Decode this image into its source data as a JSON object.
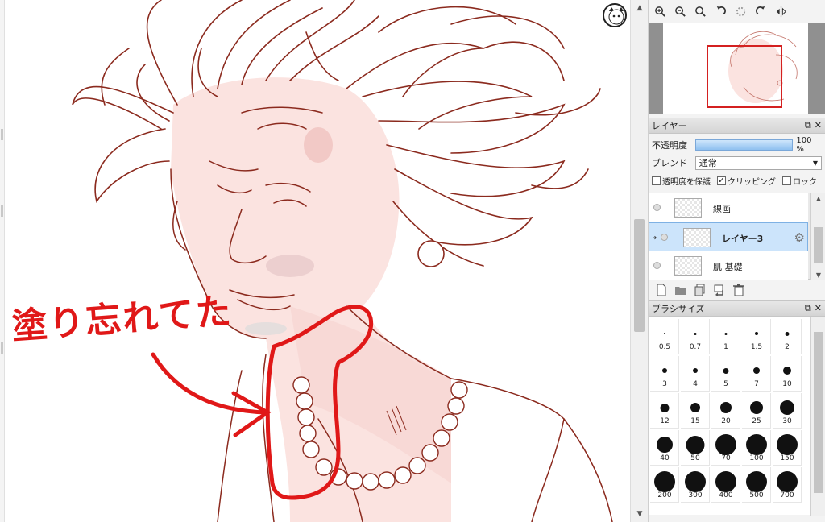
{
  "annotation": {
    "text": "塗り忘れてた",
    "color": "#e01818"
  },
  "canvas": {
    "line_color": "#8b2a1e",
    "skin_color": "#fbe0de"
  },
  "toolbar": {
    "icons": [
      "zoom-in-icon",
      "zoom-out-icon",
      "zoom-reset-icon",
      "rotate-left-icon",
      "rotate-reset-icon",
      "rotate-right-icon",
      "flip-icon"
    ]
  },
  "layer_panel": {
    "title": "レイヤー",
    "opacity_label": "不透明度",
    "opacity_value": "100 %",
    "opacity_fraction": 1.0,
    "blend_label": "ブレンド",
    "blend_value": "通常",
    "protect_label": "透明度を保護",
    "clipping_label": "クリッピング",
    "lock_label": "ロック",
    "clipping_checked": true,
    "layers": [
      {
        "name": "線画",
        "selected": false
      },
      {
        "name": "レイヤー3",
        "selected": true
      },
      {
        "name": "肌 基礎",
        "selected": false
      }
    ]
  },
  "brush_panel": {
    "title": "ブラシサイズ",
    "sizes": [
      "0.5",
      "0.7",
      "1",
      "1.5",
      "2",
      "3",
      "4",
      "5",
      "7",
      "10",
      "12",
      "15",
      "20",
      "25",
      "30",
      "40",
      "50",
      "70",
      "100",
      "150",
      "200",
      "300",
      "400",
      "500",
      "700"
    ]
  },
  "panel_controls": {
    "float": "⧉",
    "close": "✕"
  }
}
